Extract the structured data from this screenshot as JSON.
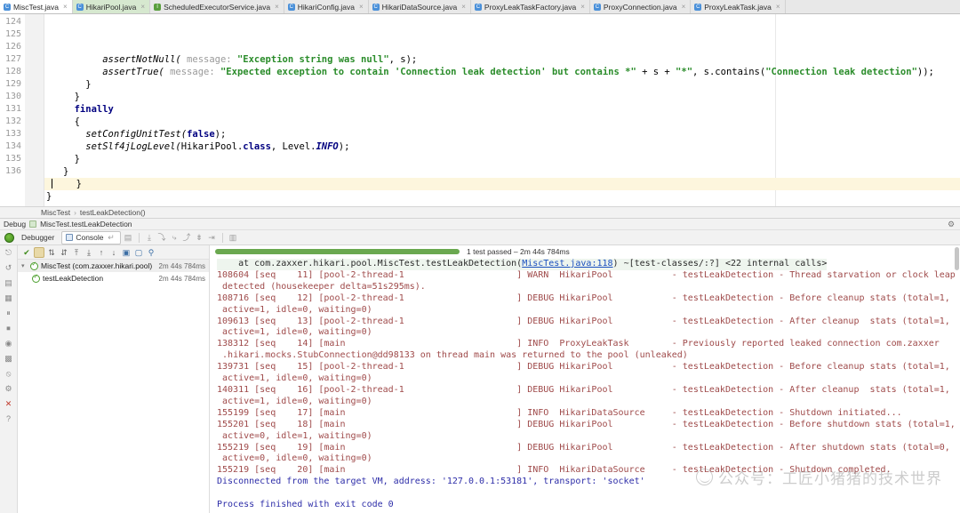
{
  "editor": {
    "tabs": [
      {
        "label": "MiscTest.java",
        "icon": "java-class-icon",
        "state": "active"
      },
      {
        "label": "HikariPool.java",
        "icon": "java-class-icon",
        "state": "selected-green"
      },
      {
        "label": "ScheduledExecutorService.java",
        "icon": "java-interface-icon",
        "state": "normal"
      },
      {
        "label": "HikariConfig.java",
        "icon": "java-class-icon",
        "state": "normal"
      },
      {
        "label": "HikariDataSource.java",
        "icon": "java-class-icon",
        "state": "normal"
      },
      {
        "label": "ProxyLeakTaskFactory.java",
        "icon": "java-class-icon",
        "state": "normal"
      },
      {
        "label": "ProxyConnection.java",
        "icon": "java-class-icon",
        "state": "normal"
      },
      {
        "label": "ProxyLeakTask.java",
        "icon": "java-class-icon",
        "state": "normal"
      }
    ],
    "close_glyph": "×",
    "line_numbers": [
      "124",
      "125",
      "126",
      "127",
      "128",
      "129",
      "130",
      "131",
      "132",
      "133",
      "134",
      "135",
      "136"
    ],
    "lines": [
      {
        "num": "124",
        "indent": 10,
        "segments": [
          {
            "t": "assertNotNull(",
            "c": "mth"
          },
          {
            "t": " message: ",
            "c": "hint"
          },
          {
            "t": "\"Exception string was null\"",
            "c": "str"
          },
          {
            "t": ", s);",
            "c": "plain"
          }
        ]
      },
      {
        "num": "125",
        "indent": 10,
        "segments": [
          {
            "t": "assertTrue(",
            "c": "mth"
          },
          {
            "t": " message: ",
            "c": "hint"
          },
          {
            "t": "\"Expected exception to contain 'Connection leak detection' but contains *\"",
            "c": "str"
          },
          {
            "t": " + s + ",
            "c": "plain"
          },
          {
            "t": "\"*\"",
            "c": "str"
          },
          {
            "t": ", s.contains(",
            "c": "plain"
          },
          {
            "t": "\"Connection leak detection\"",
            "c": "str"
          },
          {
            "t": "));",
            "c": "plain"
          }
        ]
      },
      {
        "num": "126",
        "indent": 7,
        "segments": [
          {
            "t": "}",
            "c": "plain"
          }
        ]
      },
      {
        "num": "127",
        "indent": 5,
        "segments": [
          {
            "t": "}",
            "c": "plain"
          }
        ]
      },
      {
        "num": "128",
        "indent": 5,
        "segments": [
          {
            "t": "finally",
            "c": "kw"
          }
        ]
      },
      {
        "num": "129",
        "indent": 5,
        "segments": [
          {
            "t": "{",
            "c": "plain"
          }
        ]
      },
      {
        "num": "130",
        "indent": 7,
        "segments": [
          {
            "t": "setConfigUnitTest(",
            "c": "mth"
          },
          {
            "t": "false",
            "c": "kw"
          },
          {
            "t": ");",
            "c": "plain"
          }
        ]
      },
      {
        "num": "131",
        "indent": 7,
        "segments": [
          {
            "t": "setSlf4jLogLevel(",
            "c": "mth"
          },
          {
            "t": "HikariPool.",
            "c": "plain"
          },
          {
            "t": "class",
            "c": "kw"
          },
          {
            "t": ", Level.",
            "c": "plain"
          },
          {
            "t": "INFO",
            "c": "ital"
          },
          {
            "t": ");",
            "c": "plain"
          }
        ]
      },
      {
        "num": "132",
        "indent": 5,
        "segments": [
          {
            "t": "}",
            "c": "plain"
          }
        ]
      },
      {
        "num": "133",
        "indent": 3,
        "segments": [
          {
            "t": "}",
            "c": "plain"
          }
        ]
      },
      {
        "num": "134",
        "indent": 1,
        "highlight": true,
        "caret": true,
        "segments": [
          {
            "t": "}",
            "c": "plain"
          }
        ]
      },
      {
        "num": "135",
        "indent": 0,
        "segments": [
          {
            "t": "}",
            "c": "plain"
          }
        ]
      },
      {
        "num": "136",
        "indent": 0,
        "segments": []
      }
    ]
  },
  "breadcrumb": {
    "items": [
      "MiscTest",
      "testLeakDetection()"
    ],
    "separator": "›"
  },
  "debug": {
    "window_label": "Debug",
    "config_name": "MiscTest.testLeakDetection",
    "gear_icon": "gear-icon",
    "toolbar": {
      "debugger_tab": "Debugger",
      "console_tab": "Console",
      "console_icon": "console-icon",
      "layout_icon": "layout-icon",
      "step_icons": [
        "step-over-icon",
        "step-into-icon",
        "force-step-into-icon",
        "step-out-icon",
        "drop-frame-icon",
        "run-to-cursor-icon",
        "evaluate-icon"
      ]
    },
    "rail_icons": [
      "restore-layout-icon",
      "threads-icon",
      "frames-icon",
      "variables-icon",
      "watches-icon",
      "memory-icon",
      "breakpoints-icon",
      "mute-breakpoints-icon",
      "settings-icon",
      "close-icon",
      "help-icon"
    ]
  },
  "test_runner": {
    "toolbar_icons": [
      "show-passed-icon",
      "show-ignored-icon",
      "sort-alphabetically-icon",
      "sort-by-duration-icon",
      "expand-all-icon",
      "collapse-all-icon",
      "prev-failed-icon",
      "next-failed-icon",
      "export-icon",
      "open-results-icon",
      "settings-icon"
    ],
    "tree": [
      {
        "label": "MiscTest (com.zaxxer.hikari.pool)",
        "time": "2m 44s 784ms",
        "status": "passed",
        "level": 0,
        "expanded": true
      },
      {
        "label": "testLeakDetection",
        "time": "2m 44s 784ms",
        "status": "passed",
        "level": 1
      }
    ],
    "progress": {
      "percent": 100,
      "status_text": "1 test passed – 2m 44s 784ms"
    }
  },
  "console": {
    "lines": [
      {
        "kind": "stack",
        "text": "    at com.zaxxer.hikari.pool.MiscTest.testLeakDetection(MiscTest.java:118) ~[test-classes/:?] <22 internal calls>",
        "link": "MiscTest.java:118"
      },
      {
        "kind": "log",
        "text": "108604 [seq    11] [pool-2-thread-1                     ] WARN  HikariPool           - testLeakDetection - Thread starvation or clock leap"
      },
      {
        "kind": "log",
        "text": " detected (housekeeper delta=51s295ms)."
      },
      {
        "kind": "log",
        "text": "108716 [seq    12] [pool-2-thread-1                     ] DEBUG HikariPool           - testLeakDetection - Before cleanup stats (total=1,"
      },
      {
        "kind": "log",
        "text": " active=1, idle=0, waiting=0)"
      },
      {
        "kind": "log",
        "text": "109613 [seq    13] [pool-2-thread-1                     ] DEBUG HikariPool           - testLeakDetection - After cleanup  stats (total=1,"
      },
      {
        "kind": "log",
        "text": " active=1, idle=0, waiting=0)"
      },
      {
        "kind": "log",
        "text": "138312 [seq    14] [main                                ] INFO  ProxyLeakTask        - Previously reported leaked connection com.zaxxer"
      },
      {
        "kind": "log",
        "text": " .hikari.mocks.StubConnection@dd98133 on thread main was returned to the pool (unleaked)"
      },
      {
        "kind": "log",
        "text": "139731 [seq    15] [pool-2-thread-1                     ] DEBUG HikariPool           - testLeakDetection - Before cleanup stats (total=1,"
      },
      {
        "kind": "log",
        "text": " active=1, idle=0, waiting=0)"
      },
      {
        "kind": "log",
        "text": "140311 [seq    16] [pool-2-thread-1                     ] DEBUG HikariPool           - testLeakDetection - After cleanup  stats (total=1,"
      },
      {
        "kind": "log",
        "text": " active=1, idle=0, waiting=0)"
      },
      {
        "kind": "log",
        "text": "155199 [seq    17] [main                                ] INFO  HikariDataSource     - testLeakDetection - Shutdown initiated..."
      },
      {
        "kind": "log",
        "text": "155201 [seq    18] [main                                ] DEBUG HikariPool           - testLeakDetection - Before shutdown stats (total=1,"
      },
      {
        "kind": "log",
        "text": " active=0, idle=1, waiting=0)"
      },
      {
        "kind": "log",
        "text": "155219 [seq    19] [main                                ] DEBUG HikariPool           - testLeakDetection - After shutdown stats (total=0,"
      },
      {
        "kind": "log",
        "text": " active=0, idle=0, waiting=0)"
      },
      {
        "kind": "log",
        "text": "155219 [seq    20] [main                                ] INFO  HikariDataSource     - testLeakDetection - Shutdown completed."
      },
      {
        "kind": "sys",
        "text": "Disconnected from the target VM, address: '127.0.0.1:53181', transport: 'socket'"
      },
      {
        "kind": "blank",
        "text": ""
      },
      {
        "kind": "sys",
        "text": "Process finished with exit code 0"
      }
    ]
  },
  "watermark": {
    "text": "公众号：工匠小猪猪的技术世界",
    "icon": "wechat-circle-icon"
  }
}
